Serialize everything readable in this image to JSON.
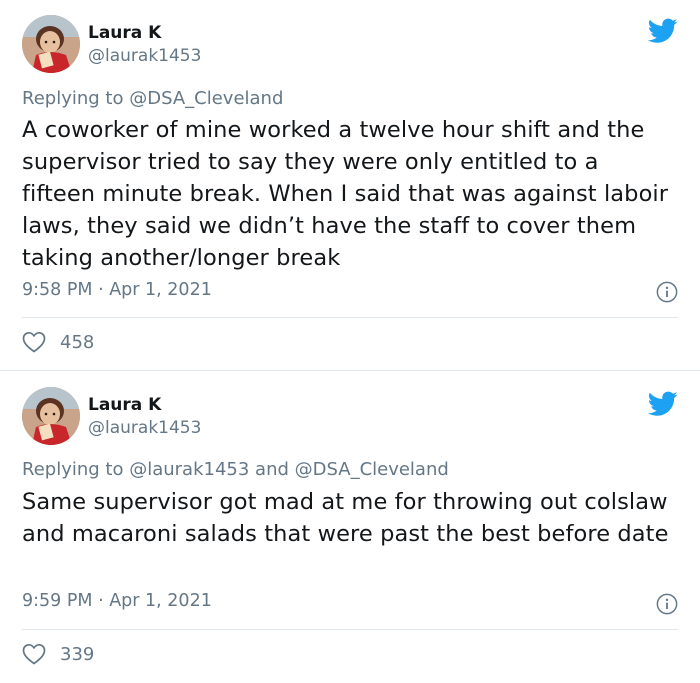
{
  "tweets": [
    {
      "author_name": "Laura K",
      "author_handle": "@laurak1453",
      "replying_label": "Replying to",
      "replying_to": "@DSA_Cleveland",
      "text": "A coworker of mine worked a twelve hour shift and the supervisor tried to say they were only entitled to a fifteen minute break. When I said that was against laboir laws, they said we didn’t have the staff to cover them taking another/longer break",
      "timestamp": "9:58 PM · Apr 1, 2021",
      "likes": "458"
    },
    {
      "author_name": "Laura K",
      "author_handle": "@laurak1453",
      "replying_label": "Replying to",
      "replying_to": "@laurak1453 and @DSA_Cleveland",
      "text": "Same supervisor got mad at me for throwing out colslaw and macaroni salads that were past the best before date",
      "timestamp": "9:59 PM · Apr 1, 2021",
      "likes": "339"
    }
  ],
  "icons": {
    "brand": "twitter-bird-icon",
    "info": "info-icon",
    "like": "heart-icon"
  },
  "colors": {
    "brand_blue": "#1da1f2",
    "secondary_text": "#657786",
    "divider": "#e1e8ed",
    "primary_text": "#14171a"
  }
}
